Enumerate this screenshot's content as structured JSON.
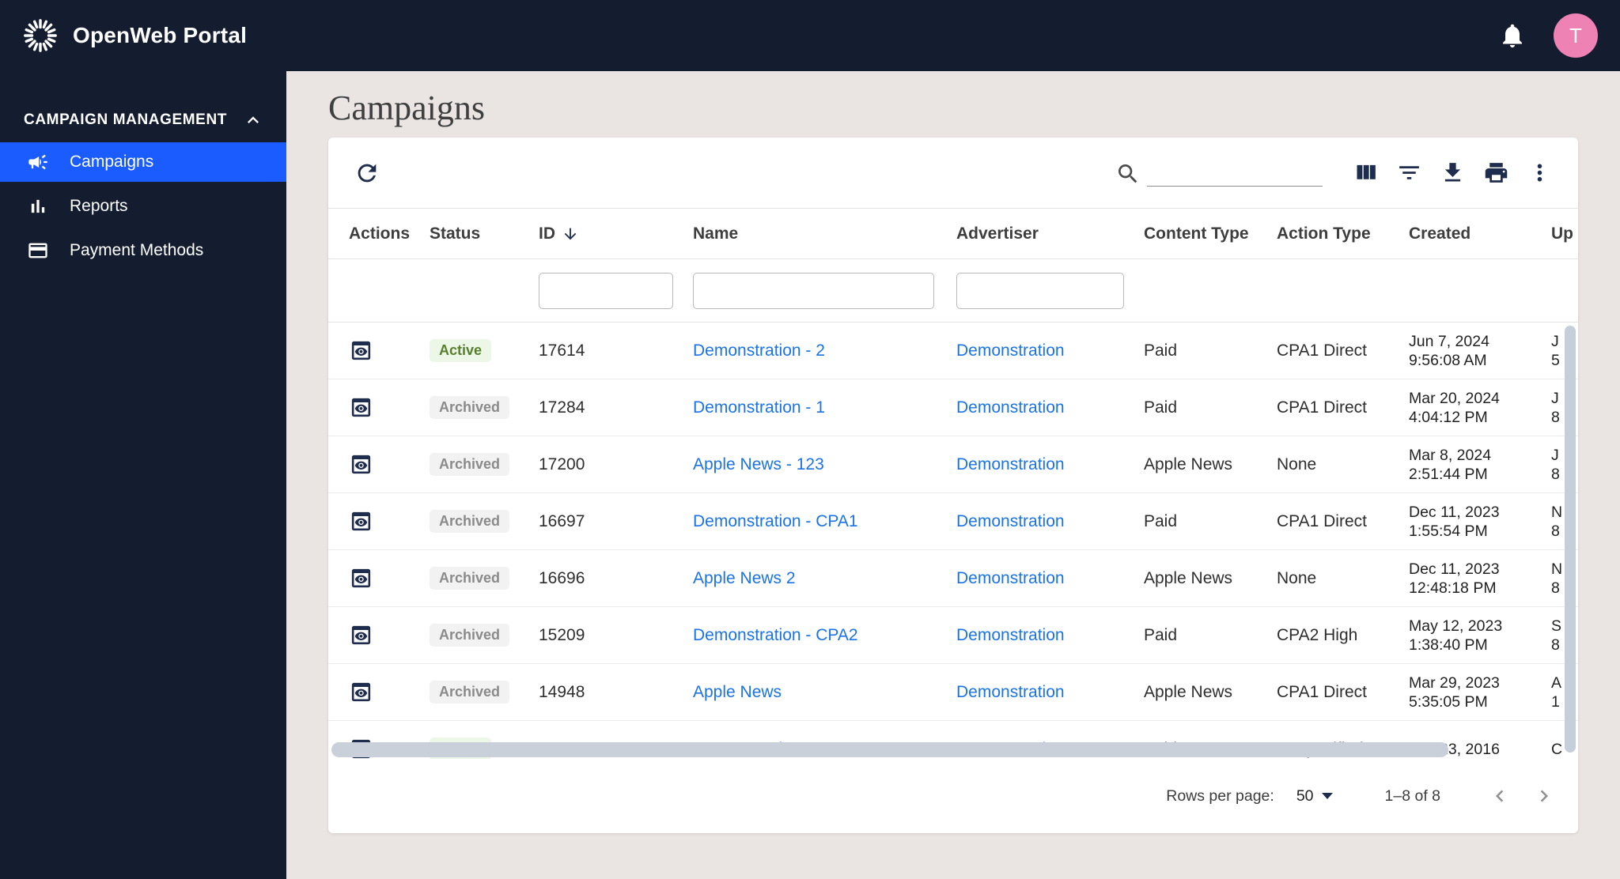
{
  "topbar": {
    "title": "OpenWeb Portal",
    "avatar_letter": "T"
  },
  "sidebar": {
    "section_label": "CAMPAIGN MANAGEMENT",
    "items": [
      {
        "label": "Campaigns",
        "icon": "campaign-megaphone",
        "active": true
      },
      {
        "label": "Reports",
        "icon": "bar-chart",
        "active": false
      },
      {
        "label": "Payment Methods",
        "icon": "credit-card",
        "active": false
      }
    ]
  },
  "page": {
    "title": "Campaigns"
  },
  "toolbar": {
    "search_value": ""
  },
  "table": {
    "columns": [
      "Actions",
      "Status",
      "ID",
      "Name",
      "Advertiser",
      "Content Type",
      "Action Type",
      "Created",
      "Up"
    ],
    "sorted_column": "ID",
    "filters": {
      "id": "",
      "name": "",
      "advertiser": ""
    },
    "rows": [
      {
        "status": "Active",
        "status_variant": "active",
        "id": "17614",
        "name": "Demonstration - 2",
        "advertiser": "Demonstration",
        "content_type": "Paid",
        "action_type": "CPA1 Direct",
        "created_date": "Jun 7, 2024",
        "created_time": "9:56:08 AM",
        "updated_1": "J",
        "updated_2": "5"
      },
      {
        "status": "Archived",
        "status_variant": "archived",
        "id": "17284",
        "name": "Demonstration - 1",
        "advertiser": "Demonstration",
        "content_type": "Paid",
        "action_type": "CPA1 Direct",
        "created_date": "Mar 20, 2024",
        "created_time": "4:04:12 PM",
        "updated_1": "J",
        "updated_2": "8"
      },
      {
        "status": "Archived",
        "status_variant": "archived",
        "id": "17200",
        "name": "Apple News - 123",
        "advertiser": "Demonstration",
        "content_type": "Apple News",
        "action_type": "None",
        "created_date": "Mar 8, 2024",
        "created_time": "2:51:44 PM",
        "updated_1": "J",
        "updated_2": "8"
      },
      {
        "status": "Archived",
        "status_variant": "archived",
        "id": "16697",
        "name": "Demonstration - CPA1",
        "advertiser": "Demonstration",
        "content_type": "Paid",
        "action_type": "CPA1 Direct",
        "created_date": "Dec 11, 2023",
        "created_time": "1:55:54 PM",
        "updated_1": "N",
        "updated_2": "8"
      },
      {
        "status": "Archived",
        "status_variant": "archived",
        "id": "16696",
        "name": "Apple News 2",
        "advertiser": "Demonstration",
        "content_type": "Apple News",
        "action_type": "None",
        "created_date": "Dec 11, 2023",
        "created_time": "12:48:18 PM",
        "updated_1": "N",
        "updated_2": "8"
      },
      {
        "status": "Archived",
        "status_variant": "archived",
        "id": "15209",
        "name": "Demonstration - CPA2",
        "advertiser": "Demonstration",
        "content_type": "Paid",
        "action_type": "CPA2 High",
        "created_date": "May 12, 2023",
        "created_time": "1:38:40 PM",
        "updated_1": "S",
        "updated_2": "8"
      },
      {
        "status": "Archived",
        "status_variant": "archived",
        "id": "14948",
        "name": "Apple News",
        "advertiser": "Demonstration",
        "content_type": "Apple News",
        "action_type": "CPA1 Direct",
        "created_date": "Mar 29, 2023",
        "created_time": "5:35:05 PM",
        "updated_1": "A",
        "updated_2": "1"
      },
      {
        "status": "Active",
        "status_variant": "active",
        "id": "1200",
        "name": "Demonstration",
        "advertiser": "Demonstration",
        "content_type": "Paid",
        "action_type": "Unspecified",
        "created_date": "Feb 23, 2016",
        "created_time": "",
        "updated_1": "C",
        "updated_2": ""
      }
    ]
  },
  "pagination": {
    "rows_per_page_label": "Rows per page:",
    "rows_per_page_value": "50",
    "range": "1–8 of 8"
  },
  "colors": {
    "topbar_bg": "#141c30",
    "accent_blue": "#1a5cff",
    "link_blue": "#1a73e8",
    "icon_navy": "#1e2c4e",
    "page_bg": "#eae4e3",
    "avatar_pink": "#ee82b4",
    "chip_active_bg": "#edf7e7",
    "chip_active_text": "#56802e",
    "chip_archived_bg": "#f2f2f2",
    "chip_archived_text": "#8a8a8a"
  }
}
